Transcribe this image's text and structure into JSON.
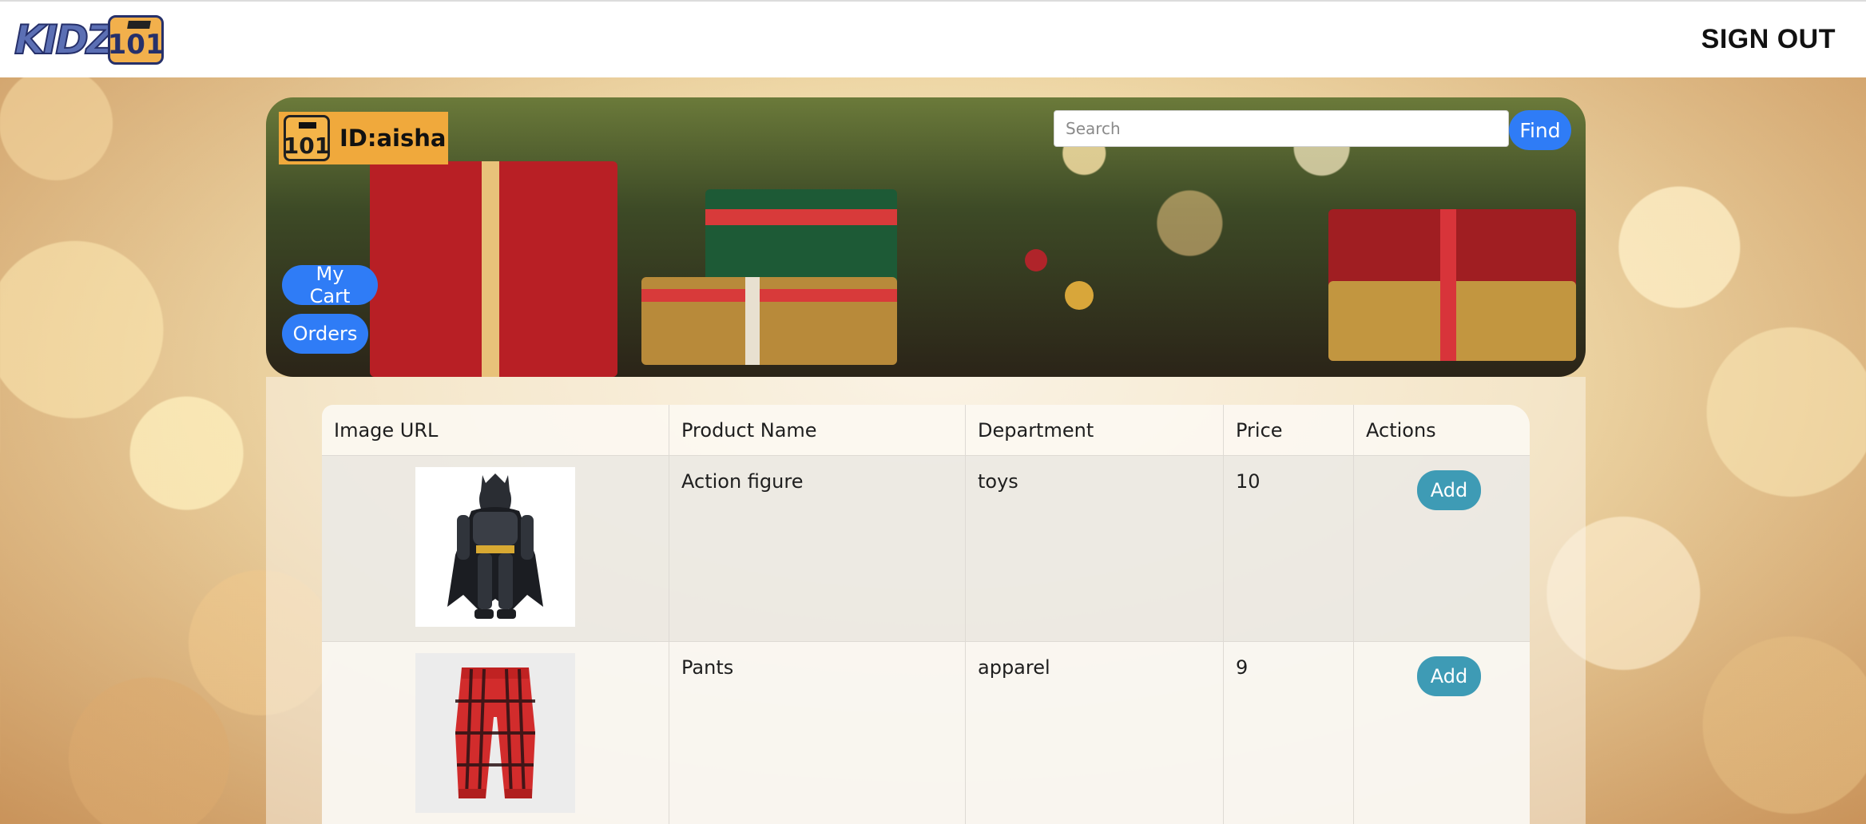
{
  "header": {
    "logo_text": "KIDZ",
    "logo_badge": "101",
    "signout_label": "SIGN OUT"
  },
  "banner": {
    "user_badge": "101",
    "user_id": "ID:aisha",
    "search_placeholder": "Search",
    "search_value": "",
    "find_label": "Find",
    "mycart_label": "My Cart",
    "orders_label": "Orders"
  },
  "table": {
    "headers": [
      "Image URL",
      "Product Name",
      "Department",
      "Price",
      "Actions"
    ],
    "rows": [
      {
        "image": "batman-action-figure",
        "name": "Action figure",
        "department": "toys",
        "price": "10",
        "action": "Add"
      },
      {
        "image": "red-plaid-pants",
        "name": "Pants",
        "department": "apparel",
        "price": "9",
        "action": "Add"
      }
    ]
  },
  "colors": {
    "primary_button": "#2f7cf6",
    "add_button": "#3e9bb5",
    "user_chip": "#f0a93c"
  }
}
